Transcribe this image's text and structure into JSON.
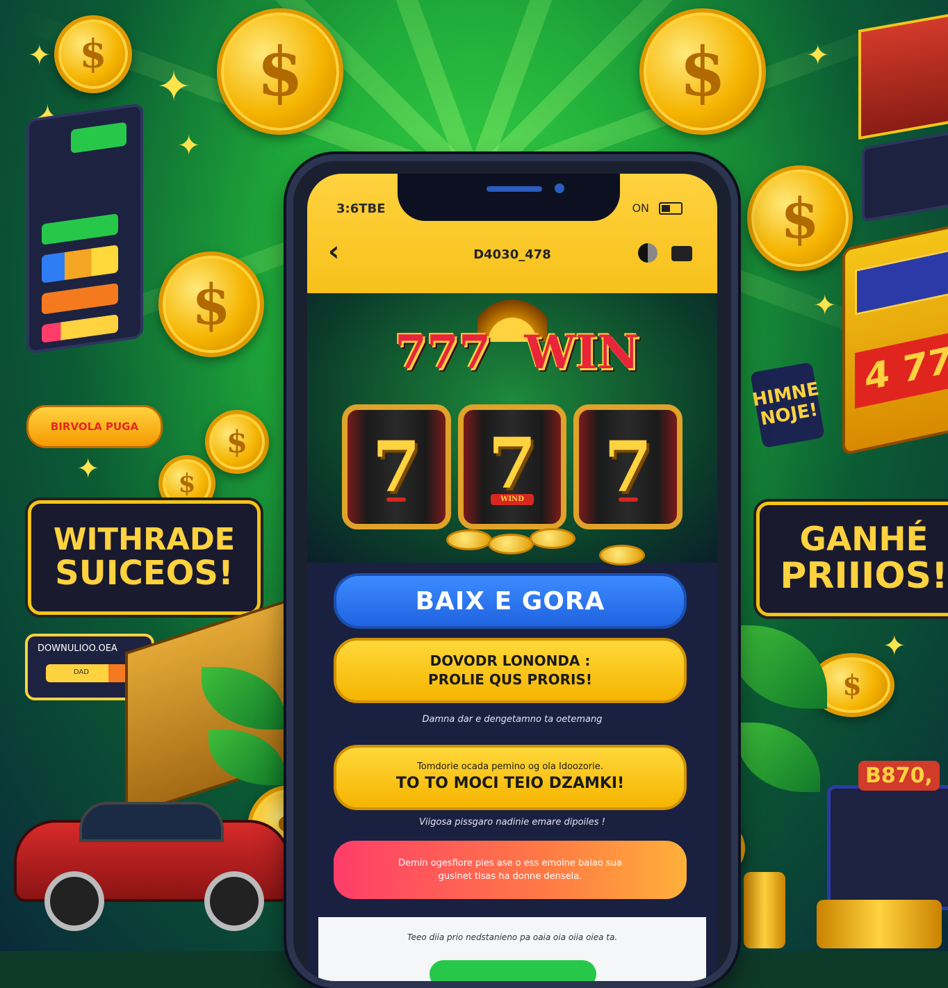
{
  "phone": {
    "status_time": "3:6TBE",
    "status_right": "ON",
    "app_title": "D4030_478",
    "back_icon": "chevron-left-icon",
    "slot": {
      "sign_left": "777",
      "sign_right": "WIN",
      "reels": [
        {
          "symbol": "7",
          "sub": ""
        },
        {
          "symbol": "7",
          "sub": "WIND"
        },
        {
          "symbol": "7",
          "sub": ""
        }
      ]
    },
    "cta_primary": "BAIX E GORA",
    "cta_secondary": {
      "line1": "DOVODR LONONDA :",
      "line2": "PROLIE QUS PRORIS!"
    },
    "caption_1": "Damna dar e dengetamno ta oetemang",
    "cta_tertiary": {
      "line1": "Tomdorie ocada pemino og ola Idoozorie.",
      "line2": "TO TO MOCI TEIO DZAMKI!"
    },
    "caption_2": "Viigosa pissgaro nadinie emare dipoiles !",
    "cta_red": {
      "line1": "Demin ogesfiore pies ase o ess emolne baiao sua",
      "line2": "gusinet tisas ha donne densela."
    },
    "footer_text": "Teeo diia prio nedstanieno pa oaia oia oiia oiea ta."
  },
  "left": {
    "pill": "BIRVOLA PUGA",
    "promo_line1": "WITHRADE",
    "promo_line2": "SUICEOS!",
    "bubble_title": "DOWNULIOO.OEA",
    "bubble_value": "DAD"
  },
  "right": {
    "hoje": "HIMNE NOJE!",
    "promo_line1": "GANHÉ",
    "promo_line2": "PRIIIOS!",
    "machine_value": "4 77",
    "sign_bottom": "B870,"
  },
  "coin_symbol": "$",
  "colors": {
    "accent_yellow": "#ffd23f",
    "accent_blue": "#1f63e0",
    "accent_green": "#27c84a",
    "accent_red": "#ff3d6a"
  }
}
